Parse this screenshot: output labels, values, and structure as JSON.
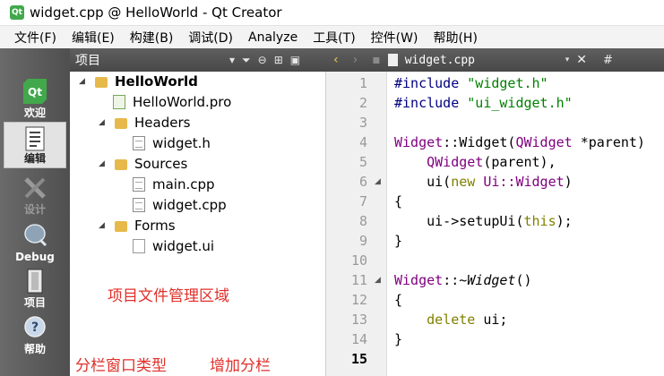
{
  "window": {
    "title": "widget.cpp @ HelloWorld - Qt Creator",
    "app_icon": "Qt"
  },
  "menubar": {
    "items": [
      "文件(F)",
      "编辑(E)",
      "构建(B)",
      "调试(D)",
      "Analyze",
      "工具(T)",
      "控件(W)",
      "帮助(H)"
    ]
  },
  "modes": [
    {
      "label": "欢迎",
      "icon": "qt-logo-icon",
      "state": "normal"
    },
    {
      "label": "编辑",
      "icon": "edit-document-icon",
      "state": "active"
    },
    {
      "label": "设计",
      "icon": "design-tools-icon",
      "state": "disabled"
    },
    {
      "label": "Debug",
      "icon": "debug-bug-icon",
      "state": "normal"
    },
    {
      "label": "项目",
      "icon": "project-icon",
      "state": "normal"
    },
    {
      "label": "帮助",
      "icon": "help-icon",
      "state": "normal"
    }
  ],
  "project_panel": {
    "view_label": "项目",
    "toolbar_icons": [
      "dropdown-icon",
      "filter-icon",
      "link-icon",
      "split-add-icon",
      "close-pane-icon"
    ]
  },
  "tree": {
    "project": "HelloWorld",
    "pro_file": "HelloWorld.pro",
    "headers": "Headers",
    "header_file": "widget.h",
    "sources": "Sources",
    "source_files": [
      "main.cpp",
      "widget.cpp"
    ],
    "forms": "Forms",
    "form_file": "widget.ui"
  },
  "annotations": {
    "file_area": "项目文件管理区域",
    "pane_type": "分栏窗口类型",
    "add_split": "增加分栏"
  },
  "editor": {
    "current_file": "widget.cpp",
    "symbol_selector": "#",
    "current_line": "15",
    "line_numbers": [
      "1",
      "2",
      "3",
      "4",
      "5",
      "6",
      "7",
      "8",
      "9",
      "10",
      "11",
      "12",
      "13",
      "14",
      "15"
    ],
    "lines": [
      "#include \"widget.h\"",
      "#include \"ui_widget.h\"",
      "",
      "Widget::Widget(QWidget *parent)",
      "    QWidget(parent),",
      "    ui(new Ui::Widget)",
      "{",
      "    ui->setupUi(this);",
      "}",
      "",
      "Widget::~Widget()",
      "{",
      "    delete ui;",
      "}",
      ""
    ]
  },
  "colors": {
    "keyword": "#808000",
    "preprocessor": "#000080",
    "string": "#008000",
    "type": "#800080",
    "annotation": "#e0302a",
    "modebar": "#5c5c5c"
  }
}
